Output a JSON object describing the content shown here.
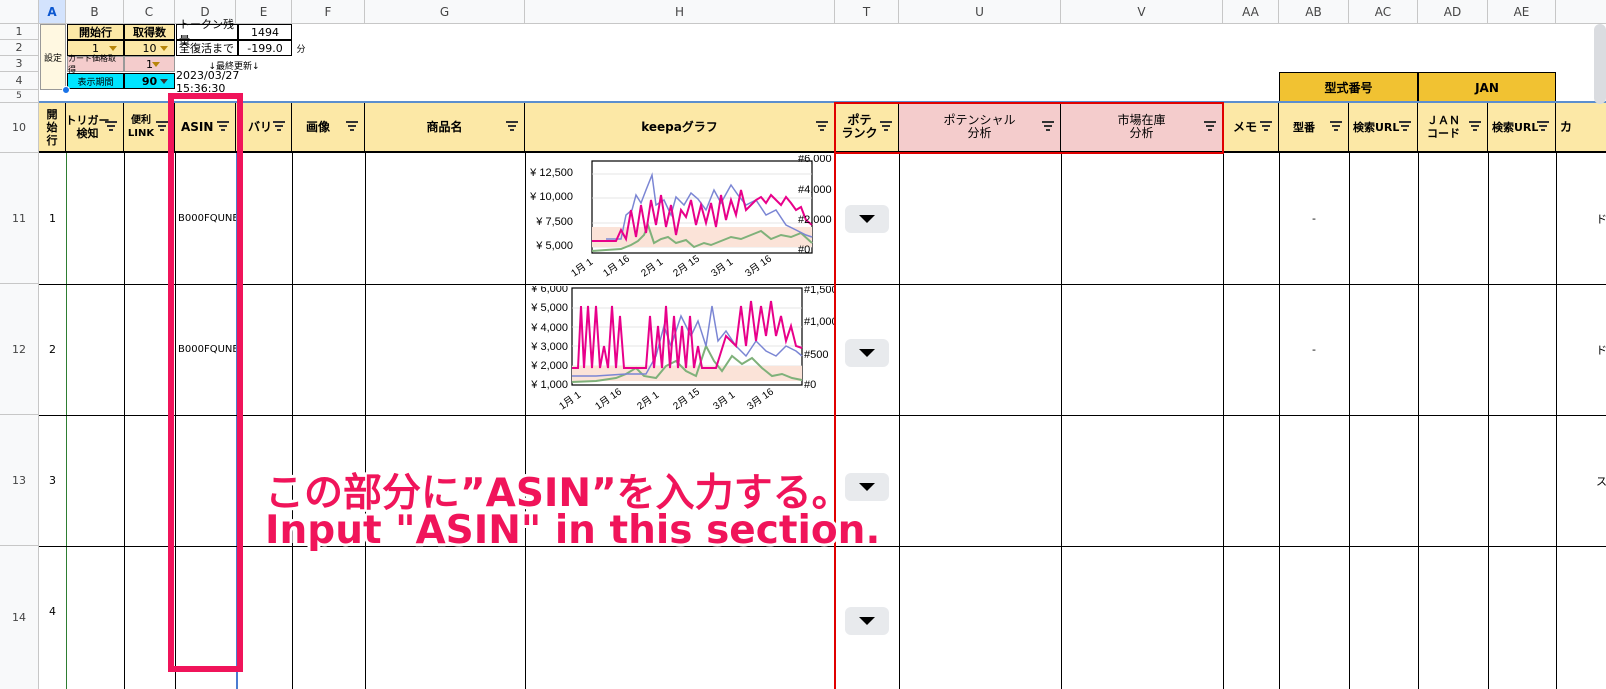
{
  "columns": [
    "A",
    "B",
    "C",
    "D",
    "E",
    "F",
    "G",
    "H",
    "T",
    "U",
    "V",
    "AA",
    "AB",
    "AC",
    "AD",
    "AE"
  ],
  "rows": [
    "1",
    "2",
    "3",
    "4",
    "5",
    "10",
    "11",
    "12",
    "13",
    "14"
  ],
  "settings": {
    "label": "設定",
    "start_row_label": "開始行",
    "fetch_count_label": "取得数",
    "start_row_value": "1",
    "fetch_count_value": "10",
    "cart_price_label": "カート価格取得",
    "cart_price_value": "1",
    "display_period_label": "表示期間",
    "display_period_value": "90",
    "token_label": "トークン残量",
    "token_value": "1494",
    "recover_label": "全復活まで",
    "recover_value": "-199.0",
    "recover_unit": "分",
    "last_update_label": "↓最終更新↓",
    "last_update_value": "2023/03/27 15:36:30"
  },
  "group_headers": {
    "model": "型式番号",
    "jan": "JAN"
  },
  "headers": {
    "start_row": "開\n始\n行",
    "trigger": "トリガー\n検知",
    "link": "便利\nLINK",
    "asin": "ASIN",
    "bari": "バリ",
    "image": "画像",
    "product": "商品名",
    "keepa": "keepaグラフ",
    "pote_rank": "ポテ\nランク",
    "potential": "ポテンシャル\n分析",
    "stock": "市場在庫\n分析",
    "memo": "メモ",
    "model_no": "型番",
    "search_url": "検索URL",
    "jan_code": "ＪＡＮ\nコード",
    "search_url2": "検索URL",
    "overflow": "カ"
  },
  "data_rows": [
    {
      "row": "11",
      "no": "1",
      "asin": "B000FQUNE",
      "dash": "-",
      "edge": "ド"
    },
    {
      "row": "12",
      "no": "2",
      "asin": "B000FQUNE",
      "dash": "-",
      "edge": "ド"
    },
    {
      "row": "13",
      "no": "3",
      "asin": "",
      "dash": "",
      "edge": "ス"
    },
    {
      "row": "14",
      "no": "4",
      "asin": "",
      "dash": "",
      "edge": ""
    }
  ],
  "chart1": {
    "left_ticks": [
      "¥ 12,500",
      "¥ 10,000",
      "¥ 7,500",
      "¥ 5,000"
    ],
    "right_ticks": [
      "#6,000",
      "#4,000",
      "#2,000",
      "#0"
    ],
    "x_ticks": [
      "1月 1",
      "1月 16",
      "2月 1",
      "2月 15",
      "3月 1",
      "3月 16"
    ]
  },
  "chart2": {
    "left_ticks": [
      "¥ 6,000",
      "¥ 5,000",
      "¥ 4,000",
      "¥ 3,000",
      "¥ 2,000",
      "¥ 1,000"
    ],
    "right_ticks": [
      "#1,500",
      "#1,000",
      "#500",
      "#0"
    ],
    "x_ticks": [
      "1月 1",
      "1月 16",
      "2月 1",
      "2月 15",
      "3月 1",
      "3月 16"
    ]
  },
  "annotation": {
    "line1": "この部分に”ASIN”を入力する。",
    "line2": "Input \"ASIN\" in this section."
  },
  "colors": {
    "header_yellow": "#fce8a6",
    "header_pink": "#f4cccc",
    "header_gold": "#f1c232",
    "annotation_red": "#f0145a",
    "keepa_pink": "#e8008a",
    "keepa_blue": "#7b86d4",
    "keepa_green": "#7fb17a"
  }
}
